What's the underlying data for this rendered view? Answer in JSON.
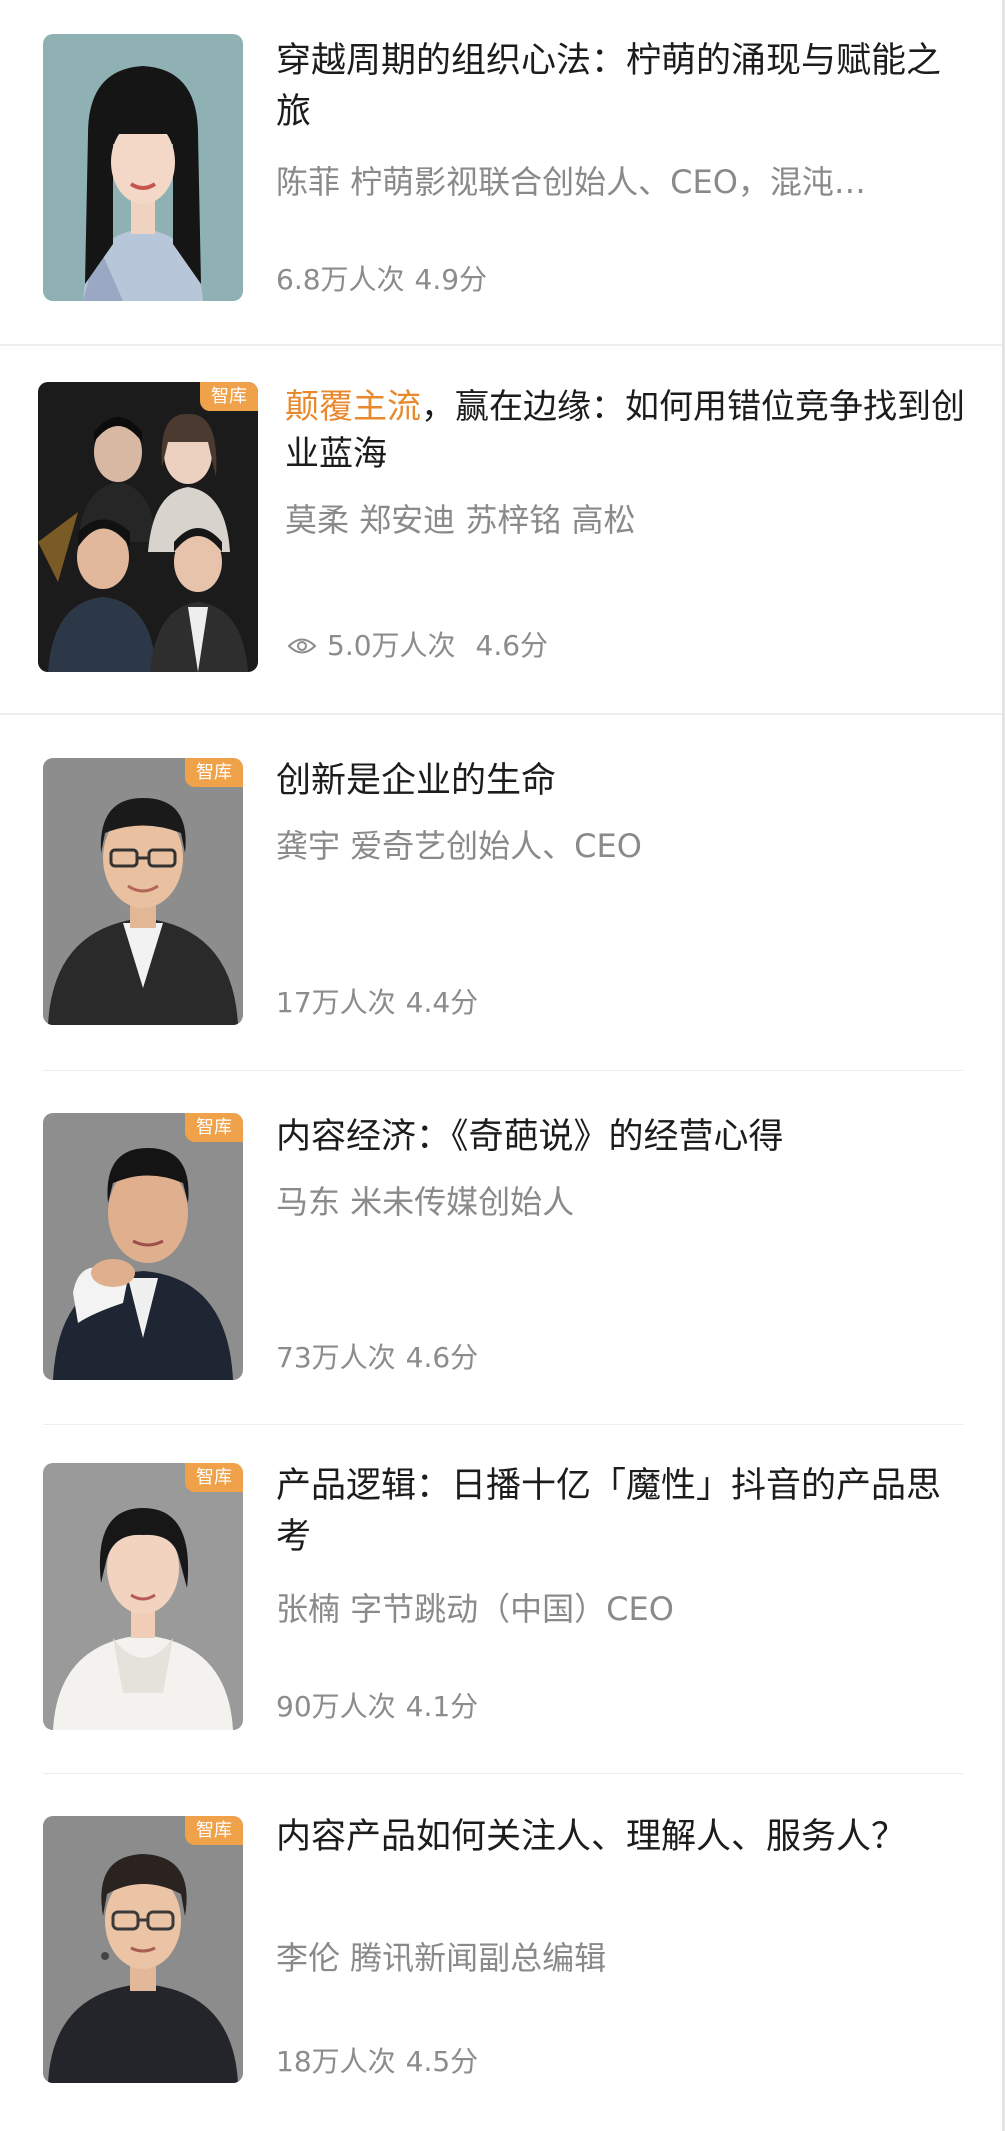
{
  "courses": [
    {
      "title": "穿越周期的组织心法：柠萌的涌现与赋能之旅",
      "subtitle": "陈菲 柠萌影视联合创始人、CEO，混沌…",
      "views": "6.8万人次",
      "rating": "4.9分",
      "thumb_icon": "portrait-woman-bangs"
    },
    {
      "title_highlight": "颠覆主流",
      "title": "，赢在边缘：如何用错位竞争找到创业蓝海",
      "subtitle": "莫柔 郑安迪 苏梓铭 高松",
      "views": "5.0万人次",
      "rating": "4.6分",
      "tag": "智库",
      "thumb_icon": "group-portrait-four",
      "stat_icon": "eye-icon"
    },
    {
      "title": "创新是企业的生命",
      "subtitle": "龚宇 爱奇艺创始人、CEO",
      "views": "17万人次",
      "rating": "4.4分",
      "tag": "智库",
      "thumb_icon": "portrait-man-glasses"
    },
    {
      "title": "内容经济：《奇葩说》的经营心得",
      "subtitle": "马东 米未传媒创始人",
      "views": "73万人次",
      "rating": "4.6分",
      "tag": "智库",
      "thumb_icon": "portrait-man-hand-chin"
    },
    {
      "title": "产品逻辑：日播十亿「魔性」抖音的产品思考",
      "subtitle": "张楠 字节跳动（中国）CEO",
      "views": "90万人次",
      "rating": "4.1分",
      "tag": "智库",
      "thumb_icon": "portrait-woman-short-hair"
    },
    {
      "title": "内容产品如何关注人、理解人、服务人？",
      "subtitle": "李伦 腾讯新闻副总编辑",
      "views": "18万人次",
      "rating": "4.5分",
      "tag": "智库",
      "thumb_icon": "portrait-man-glasses-mic"
    }
  ],
  "colors": {
    "accent": "#e8892d",
    "tag_bg": "#f0a24a",
    "muted_text": "#8a8a8a"
  }
}
